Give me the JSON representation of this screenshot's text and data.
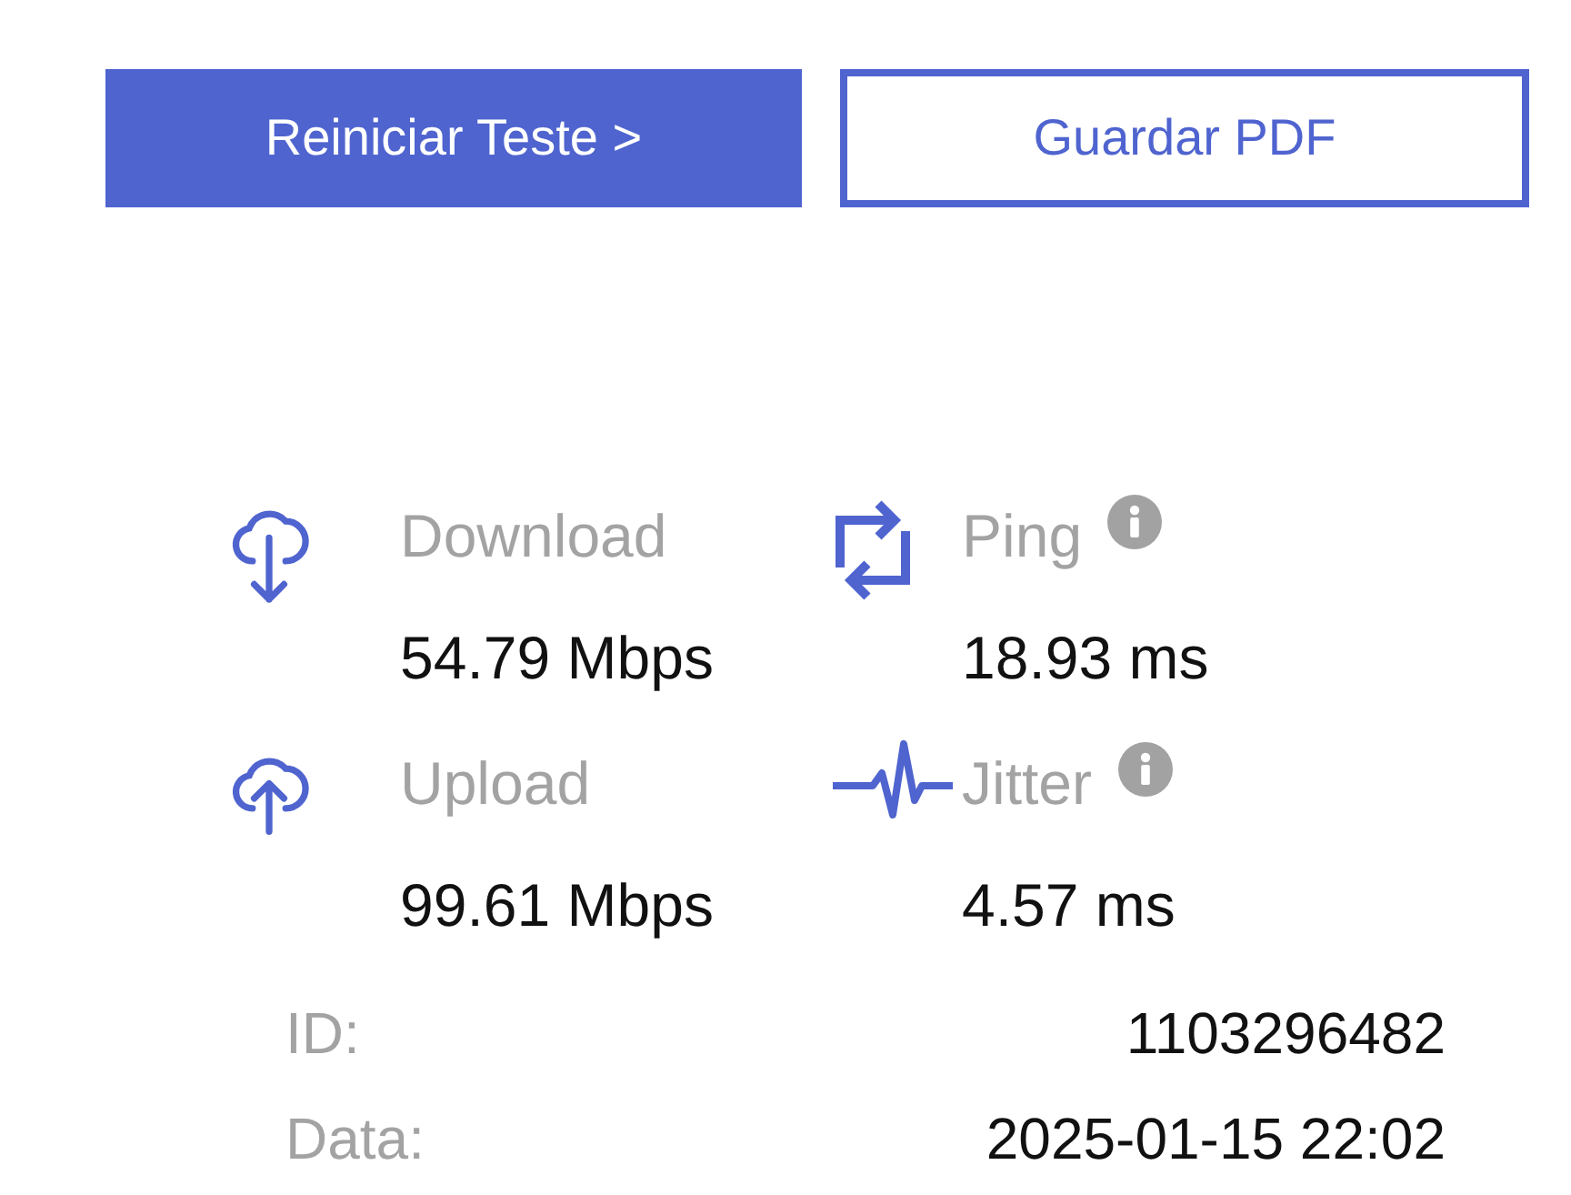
{
  "buttons": [
    {
      "label": "Reiniciar Teste >",
      "kind": "primary"
    },
    {
      "label": "Guardar PDF",
      "kind": "outline"
    }
  ],
  "metrics": [
    {
      "kind": "download",
      "label": "Download",
      "value": "54.79 Mbps",
      "info": false
    },
    {
      "kind": "ping",
      "label": "Ping",
      "value": "18.93 ms",
      "info": true
    },
    {
      "kind": "upload",
      "label": "Upload",
      "value": "99.61 Mbps",
      "info": false
    },
    {
      "kind": "jitter",
      "label": "Jitter",
      "value": "4.57 ms",
      "info": true
    }
  ],
  "details": [
    {
      "label": "ID:",
      "value": "1103296482"
    },
    {
      "label": "Data:",
      "value": "2025-01-15 22:02"
    }
  ]
}
